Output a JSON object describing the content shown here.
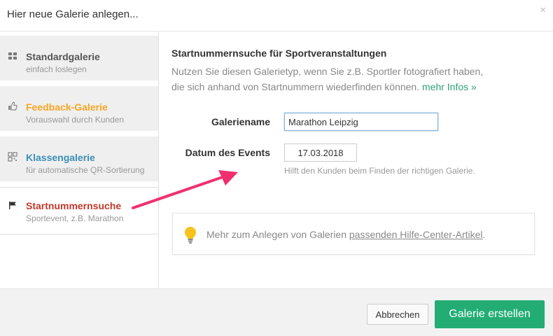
{
  "dialog": {
    "title": "Hier neue Galerie anlegen...",
    "close_label": "×"
  },
  "sidebar": {
    "items": [
      {
        "label": "Standardgalerie",
        "sub": "einfach loslegen",
        "color": "#555555",
        "icon": "grid-icon"
      },
      {
        "label": "Feedback-Galerie",
        "sub": "Vorauswahl durch Kunden",
        "color": "#f5a623",
        "icon": "thumbs-up-icon"
      },
      {
        "label": "Klassengalerie",
        "sub": "für automatische QR-Sortierung",
        "color": "#3a8fb7",
        "icon": "qr-code-icon"
      },
      {
        "label": "Startnummernsuche",
        "sub": "Sportevent, z.B. Marathon",
        "color": "#c0392b",
        "icon": "flag-icon",
        "selected": true
      }
    ]
  },
  "main": {
    "title": "Startnummernsuche für Sportveranstaltungen",
    "description": "Nutzen Sie diesen Galerietyp, wenn Sie z.B. Sportler fotografiert haben, die sich anhand von Startnummern wiederfinden können.",
    "more_link": "mehr Infos »",
    "gallery_name_label": "Galeriename",
    "gallery_name_value": "Marathon Leipzig",
    "event_date_label": "Datum des Events",
    "event_date_value": "17.03.2018",
    "event_date_hint": "Hilft den Kunden beim Finden der richtigen Galerie.",
    "info_text": "Mehr zum Anlegen von Galerien",
    "info_link": "passenden Hilfe-Center-Artikel",
    "info_end": "."
  },
  "footer": {
    "cancel_label": "Abbrechen",
    "create_label": "Galerie erstellen"
  },
  "colors": {
    "accent_green": "#23ad74",
    "annotation_arrow": "#f0306e"
  }
}
